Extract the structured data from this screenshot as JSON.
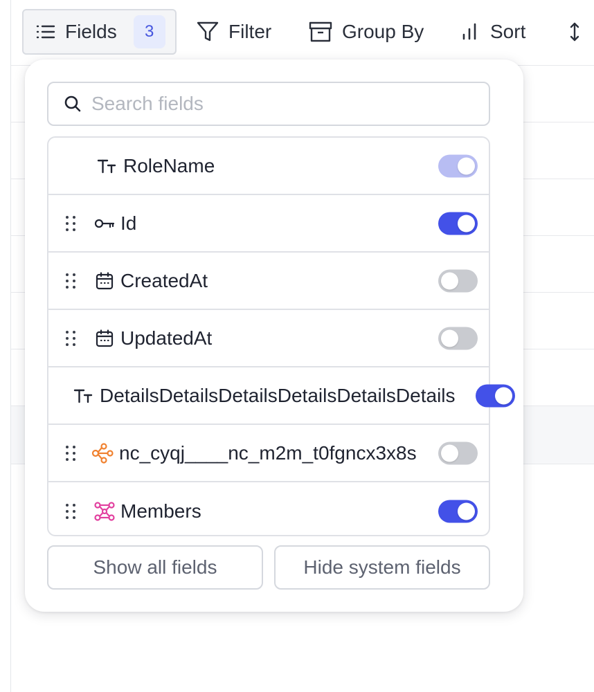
{
  "toolbar": {
    "fields_label": "Fields",
    "fields_count": "3",
    "filter_label": "Filter",
    "group_by_label": "Group By",
    "sort_label": "Sort"
  },
  "popup": {
    "search_placeholder": "Search fields",
    "fields": [
      {
        "name": "RoleName",
        "icon": "text-type-icon",
        "enabled": true,
        "locked": true
      },
      {
        "name": "Id",
        "icon": "key-icon",
        "enabled": true
      },
      {
        "name": "CreatedAt",
        "icon": "calendar-icon",
        "enabled": false
      },
      {
        "name": "UpdatedAt",
        "icon": "calendar-icon",
        "enabled": false
      },
      {
        "name": "DetailsDetailsDetailsDetailsDetailsDetails",
        "icon": "text-type-icon",
        "enabled": true
      },
      {
        "name": "nc_cyqj____nc_m2m_t0fgncx3x8s",
        "icon": "relation-icon",
        "enabled": false
      },
      {
        "name": "Members",
        "icon": "many-to-many-icon",
        "enabled": true
      }
    ],
    "show_all_label": "Show all fields",
    "hide_system_label": "Hide system fields"
  },
  "colors": {
    "accent": "#4351e8",
    "toggle_off": "#c9cbd0",
    "relation_icon": "#f0812f",
    "m2m_icon": "#e2409f"
  }
}
